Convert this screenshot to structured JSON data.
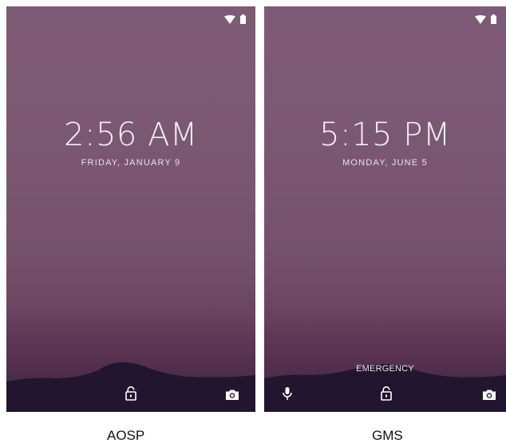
{
  "screens": [
    {
      "id": "aosp",
      "time": "2:56 AM",
      "date": "FRIDAY, JANUARY 9",
      "caption": "AOSP",
      "has_emergency": false,
      "has_voice": false
    },
    {
      "id": "gms",
      "time": "5:15 PM",
      "date": "MONDAY, JUNE 5",
      "caption": "GMS",
      "emergency_label": "EMERGENCY",
      "has_emergency": true,
      "has_voice": true
    }
  ],
  "icons": {
    "status": [
      "wifi-icon",
      "battery-icon"
    ],
    "bottom_aosp": [
      "lock-icon",
      "camera-icon"
    ],
    "bottom_gms": [
      "microphone-icon",
      "lock-icon",
      "camera-icon"
    ]
  },
  "colors": {
    "wallpaper_top": "#7e5b74",
    "wallpaper_mid": "#6b4661",
    "wallpaper_bottom": "#3b2140",
    "hills": "#221530",
    "text": "#f2eef2"
  }
}
